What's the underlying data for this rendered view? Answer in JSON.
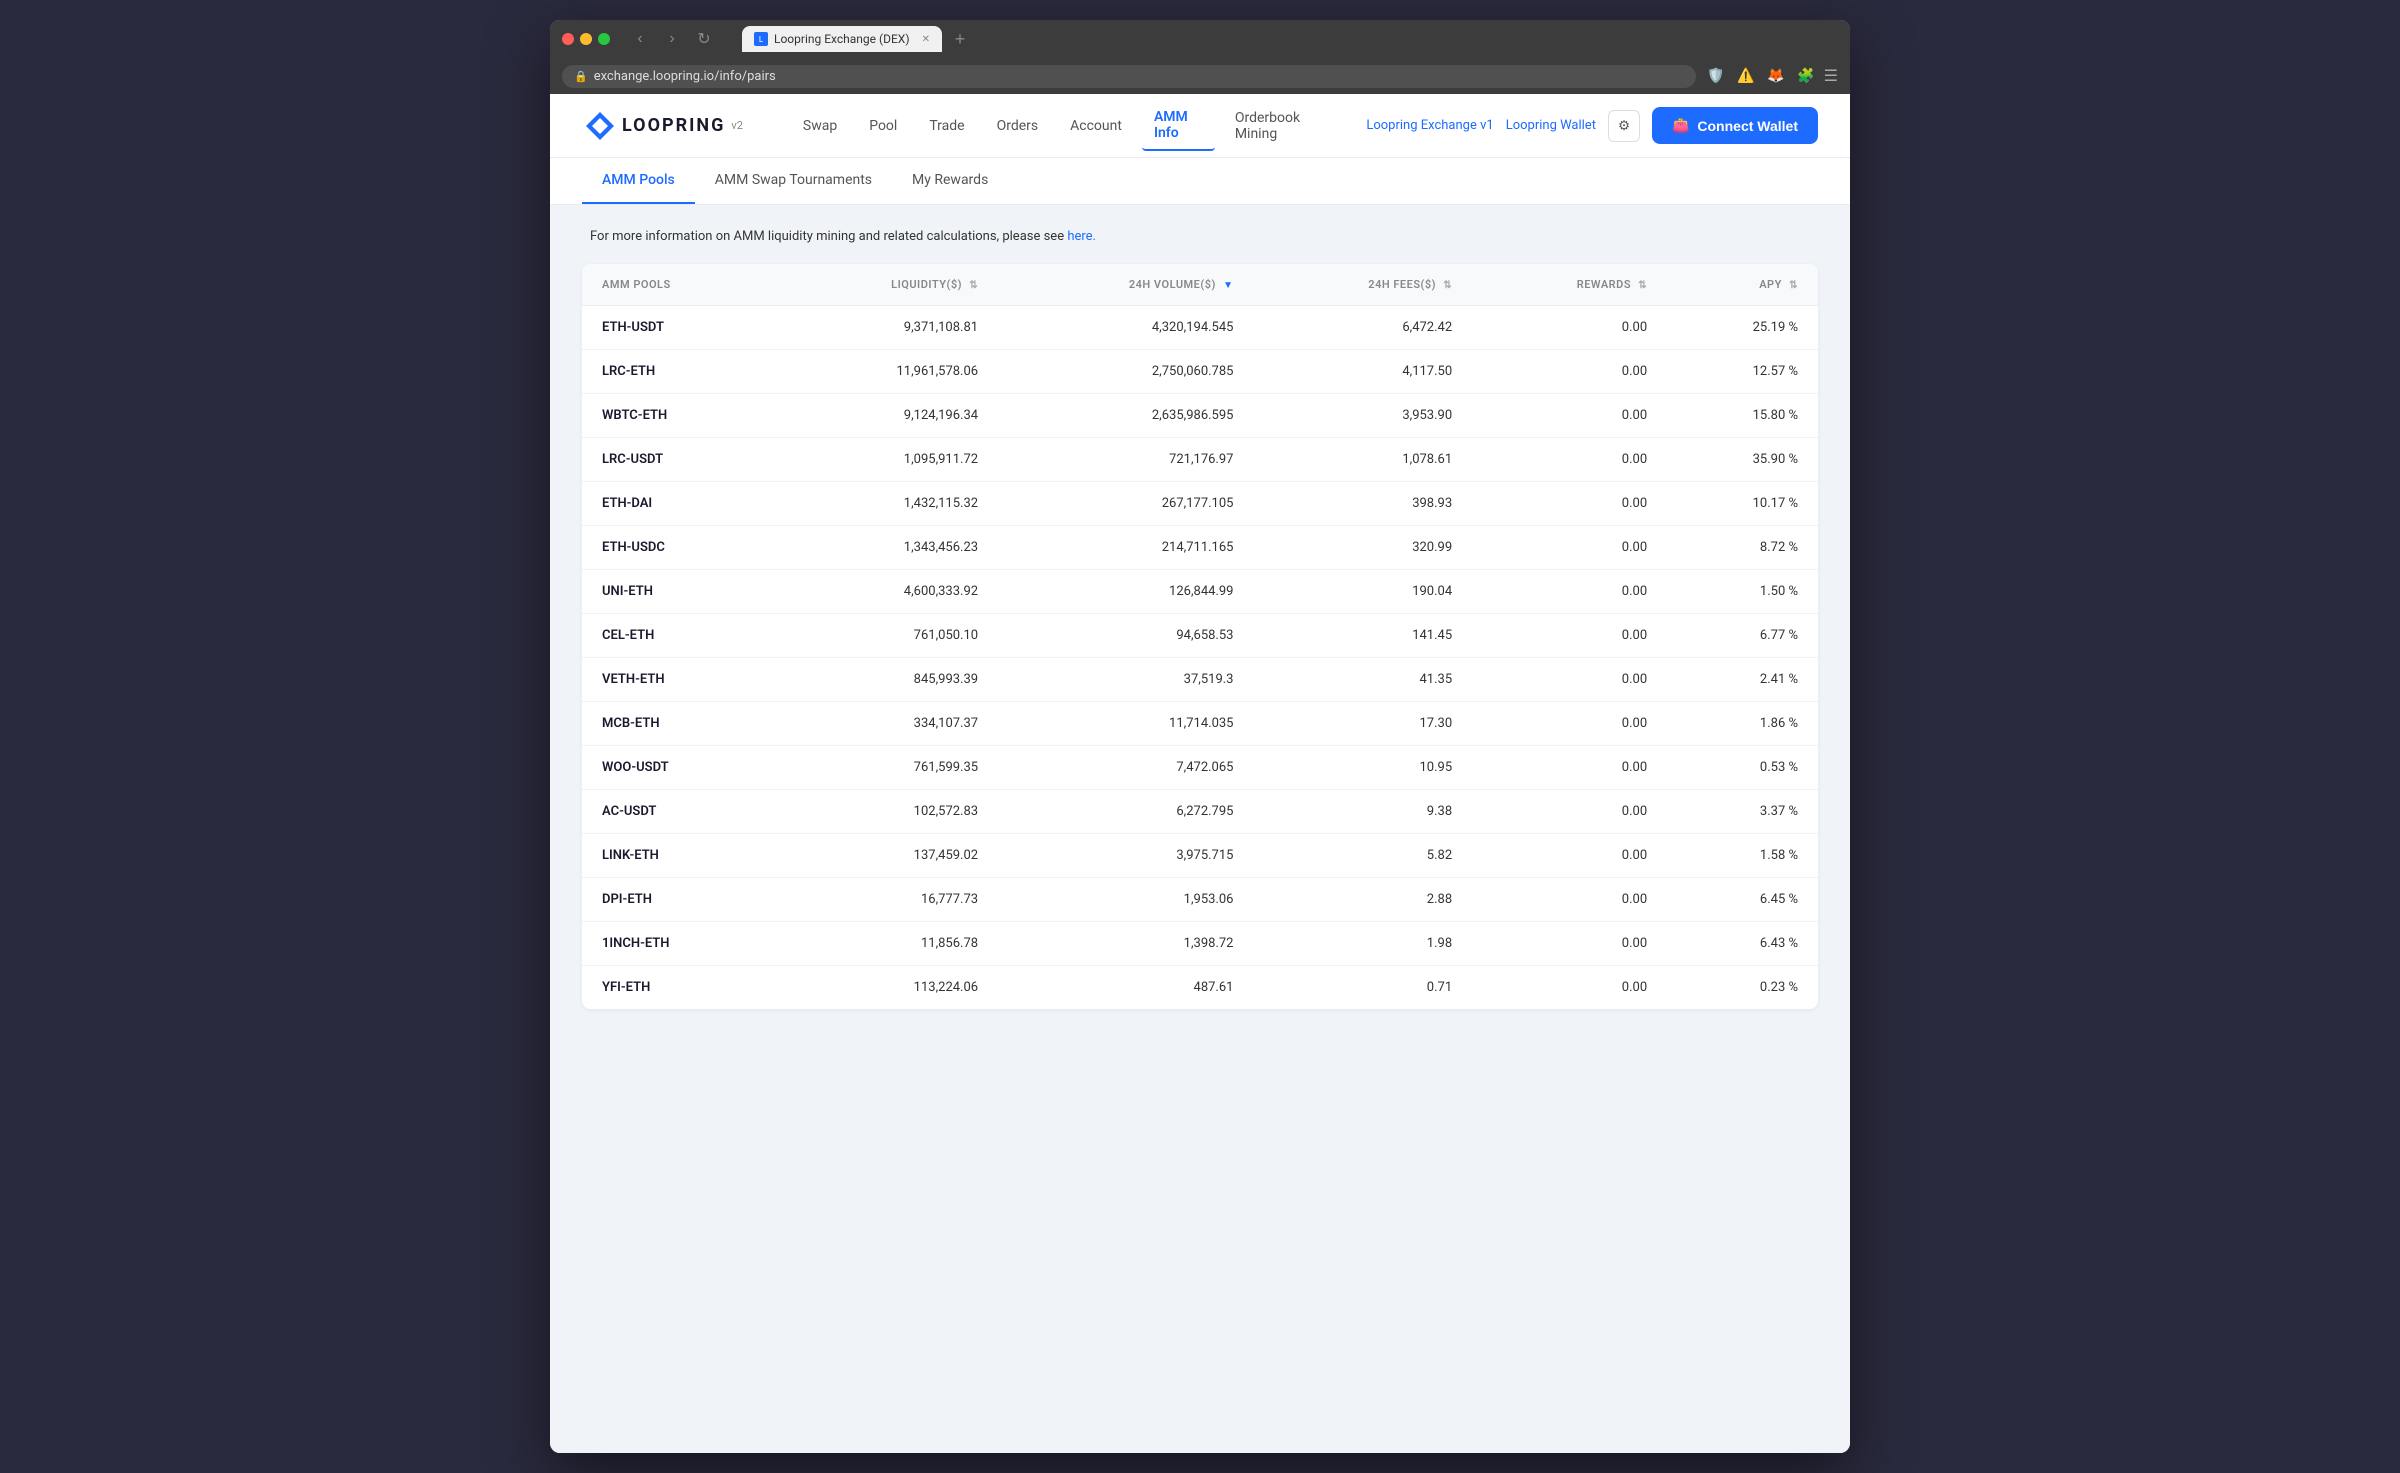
{
  "browser": {
    "tab_title": "Loopring Exchange (DEX)",
    "url": "exchange.loopring.io/info/pairs",
    "new_tab_label": "+"
  },
  "nav": {
    "logo_text": "LOOPRING",
    "logo_version": "v2",
    "links": [
      {
        "label": "Swap",
        "active": false
      },
      {
        "label": "Pool",
        "active": false
      },
      {
        "label": "Trade",
        "active": false
      },
      {
        "label": "Orders",
        "active": false
      },
      {
        "label": "Account",
        "active": false
      },
      {
        "label": "AMM Info",
        "active": true
      },
      {
        "label": "Orderbook Mining",
        "active": false
      }
    ],
    "ext_link1": "Loopring Exchange v1",
    "ext_link2": "Loopring Wallet",
    "connect_wallet": "Connect Wallet"
  },
  "sub_nav": {
    "items": [
      {
        "label": "AMM Pools",
        "active": true
      },
      {
        "label": "AMM Swap Tournaments",
        "active": false
      },
      {
        "label": "My Rewards",
        "active": false
      }
    ]
  },
  "info_text": "For more information on AMM liquidity mining and related calculations, please see",
  "info_link": "here.",
  "table": {
    "headers": [
      {
        "label": "AMM POOLS",
        "align": "left",
        "sortable": false
      },
      {
        "label": "LIQUIDITY($)",
        "align": "right",
        "sortable": true
      },
      {
        "label": "24H VOLUME($)",
        "align": "right",
        "sortable": true,
        "sorted": true
      },
      {
        "label": "24H FEES($)",
        "align": "right",
        "sortable": true
      },
      {
        "label": "REWARDS",
        "align": "right",
        "sortable": true
      },
      {
        "label": "APY",
        "align": "right",
        "sortable": true
      }
    ],
    "rows": [
      {
        "pair": "ETH-USDT",
        "liquidity": "9,371,108.81",
        "volume": "4,320,194.545",
        "fees": "6,472.42",
        "rewards": "0.00",
        "apy": "25.19 %"
      },
      {
        "pair": "LRC-ETH",
        "liquidity": "11,961,578.06",
        "volume": "2,750,060.785",
        "fees": "4,117.50",
        "rewards": "0.00",
        "apy": "12.57 %"
      },
      {
        "pair": "WBTC-ETH",
        "liquidity": "9,124,196.34",
        "volume": "2,635,986.595",
        "fees": "3,953.90",
        "rewards": "0.00",
        "apy": "15.80 %"
      },
      {
        "pair": "LRC-USDT",
        "liquidity": "1,095,911.72",
        "volume": "721,176.97",
        "fees": "1,078.61",
        "rewards": "0.00",
        "apy": "35.90 %"
      },
      {
        "pair": "ETH-DAI",
        "liquidity": "1,432,115.32",
        "volume": "267,177.105",
        "fees": "398.93",
        "rewards": "0.00",
        "apy": "10.17 %"
      },
      {
        "pair": "ETH-USDC",
        "liquidity": "1,343,456.23",
        "volume": "214,711.165",
        "fees": "320.99",
        "rewards": "0.00",
        "apy": "8.72 %"
      },
      {
        "pair": "UNI-ETH",
        "liquidity": "4,600,333.92",
        "volume": "126,844.99",
        "fees": "190.04",
        "rewards": "0.00",
        "apy": "1.50 %"
      },
      {
        "pair": "CEL-ETH",
        "liquidity": "761,050.10",
        "volume": "94,658.53",
        "fees": "141.45",
        "rewards": "0.00",
        "apy": "6.77 %"
      },
      {
        "pair": "VETH-ETH",
        "liquidity": "845,993.39",
        "volume": "37,519.3",
        "fees": "41.35",
        "rewards": "0.00",
        "apy": "2.41 %"
      },
      {
        "pair": "MCB-ETH",
        "liquidity": "334,107.37",
        "volume": "11,714.035",
        "fees": "17.30",
        "rewards": "0.00",
        "apy": "1.86 %"
      },
      {
        "pair": "WOO-USDT",
        "liquidity": "761,599.35",
        "volume": "7,472.065",
        "fees": "10.95",
        "rewards": "0.00",
        "apy": "0.53 %"
      },
      {
        "pair": "AC-USDT",
        "liquidity": "102,572.83",
        "volume": "6,272.795",
        "fees": "9.38",
        "rewards": "0.00",
        "apy": "3.37 %"
      },
      {
        "pair": "LINK-ETH",
        "liquidity": "137,459.02",
        "volume": "3,975.715",
        "fees": "5.82",
        "rewards": "0.00",
        "apy": "1.58 %"
      },
      {
        "pair": "DPI-ETH",
        "liquidity": "16,777.73",
        "volume": "1,953.06",
        "fees": "2.88",
        "rewards": "0.00",
        "apy": "6.45 %"
      },
      {
        "pair": "1INCH-ETH",
        "liquidity": "11,856.78",
        "volume": "1,398.72",
        "fees": "1.98",
        "rewards": "0.00",
        "apy": "6.43 %"
      },
      {
        "pair": "YFI-ETH",
        "liquidity": "113,224.06",
        "volume": "487.61",
        "fees": "0.71",
        "rewards": "0.00",
        "apy": "0.23 %"
      }
    ]
  }
}
